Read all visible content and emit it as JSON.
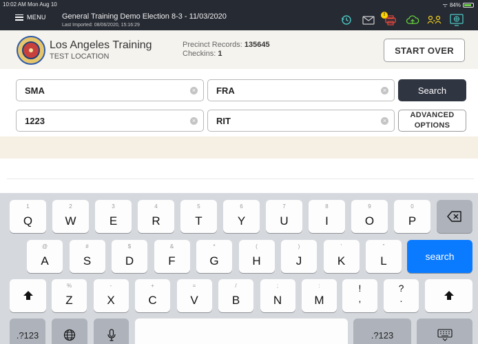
{
  "status_bar": {
    "time": "10:02 AM  Mon Aug 10",
    "battery": "84%",
    "battery_level": 0.84
  },
  "topbar": {
    "menu_label": "MENU",
    "title": "General Training  Demo Election 8-3 - 11/03/2020",
    "subtitle": "Last Imported: 08/06/2020, 15:16:29",
    "alert_badge": "!",
    "icons": [
      "history-icon",
      "mail-icon",
      "alert-printer-icon",
      "cloud-sync-icon",
      "users-icon",
      "network-status-icon"
    ],
    "icon_colors": {
      "accent": "#4cc4c1",
      "green": "#66d43b",
      "yellow": "#f3d21c",
      "red": "#e2483e"
    }
  },
  "header": {
    "location_name": "Los Angeles Training",
    "location_sub": "TEST LOCATION",
    "precinct_label": "Precinct Records:",
    "precinct_value": "135645",
    "checkins_label": "Checkins:",
    "checkins_value": "1",
    "start_over": "START OVER"
  },
  "search": {
    "last_name": "SMA",
    "first_name": "FRA",
    "house_number": "1223",
    "street_name": "RIT",
    "search_label": "Search",
    "advanced_line1": "ADVANCED",
    "advanced_line2": "OPTIONS"
  },
  "keyboard": {
    "row1": [
      {
        "hint": "1",
        "ch": "Q"
      },
      {
        "hint": "2",
        "ch": "W"
      },
      {
        "hint": "3",
        "ch": "E"
      },
      {
        "hint": "4",
        "ch": "R"
      },
      {
        "hint": "5",
        "ch": "T"
      },
      {
        "hint": "6",
        "ch": "Y"
      },
      {
        "hint": "7",
        "ch": "U"
      },
      {
        "hint": "8",
        "ch": "I"
      },
      {
        "hint": "9",
        "ch": "O"
      },
      {
        "hint": "0",
        "ch": "P"
      }
    ],
    "row2": [
      {
        "hint": "@",
        "ch": "A"
      },
      {
        "hint": "#",
        "ch": "S"
      },
      {
        "hint": "$",
        "ch": "D"
      },
      {
        "hint": "&",
        "ch": "F"
      },
      {
        "hint": "*",
        "ch": "G"
      },
      {
        "hint": "(",
        "ch": "H"
      },
      {
        "hint": ")",
        "ch": "J"
      },
      {
        "hint": "'",
        "ch": "K"
      },
      {
        "hint": "\"",
        "ch": "L"
      }
    ],
    "row3": [
      {
        "hint": "%",
        "ch": "Z"
      },
      {
        "hint": "-",
        "ch": "X"
      },
      {
        "hint": "+",
        "ch": "C"
      },
      {
        "hint": "=",
        "ch": "V"
      },
      {
        "hint": "/",
        "ch": "B"
      },
      {
        "hint": ";",
        "ch": "N"
      },
      {
        "hint": ":",
        "ch": "M"
      }
    ],
    "punct1": {
      "top": "!",
      "bottom": ","
    },
    "punct2": {
      "top": "?",
      "bottom": "."
    },
    "search_key": "search",
    "numbers_key": ".?123"
  }
}
